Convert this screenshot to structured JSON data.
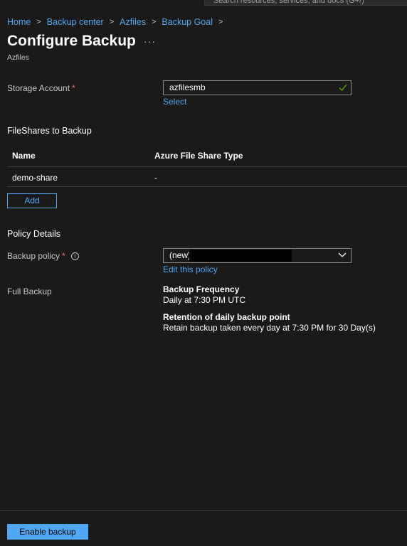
{
  "search": {
    "placeholder": "Search resources, services, and docs (G+/)"
  },
  "breadcrumb": [
    "Home",
    "Backup center",
    "Azfiles",
    "Backup Goal"
  ],
  "page": {
    "title": "Configure Backup",
    "more": "···",
    "subtitle": "Azfiles"
  },
  "storage_account": {
    "label": "Storage Account",
    "required_mark": "*",
    "value": "azfilesmb",
    "select_link": "Select"
  },
  "fileshares": {
    "heading": "FileShares to Backup",
    "columns": [
      "Name",
      "Azure File Share Type"
    ],
    "rows": [
      {
        "name": "demo-share",
        "type": "-"
      }
    ],
    "add_label": "Add"
  },
  "policy": {
    "heading": "Policy Details",
    "label": "Backup policy",
    "required_mark": "*",
    "info": "i",
    "selected": "(new)",
    "edit_link": "Edit this policy"
  },
  "full_backup": {
    "label": "Full Backup",
    "frequency_title": "Backup Frequency",
    "frequency_text": "Daily at 7:30 PM UTC",
    "retention_title": "Retention of daily backup point",
    "retention_text": "Retain backup taken every day at 7:30 PM for 30 Day(s)"
  },
  "footer": {
    "enable_label": "Enable backup"
  },
  "colors": {
    "accent": "#4ea8f5",
    "background": "#1b1a19",
    "required": "#f1707b",
    "valid": "#57a300"
  }
}
